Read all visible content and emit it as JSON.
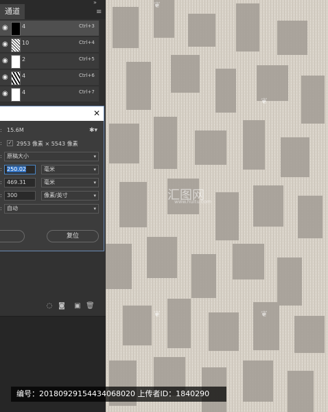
{
  "panel": {
    "tab_label": "通道",
    "collapse_glyph": "»",
    "menu_icon": "menu-lines-icon",
    "channels": [
      {
        "name": "4",
        "shortcut": "Ctrl+3",
        "thumb": "black",
        "selected": true
      },
      {
        "name": "10",
        "shortcut": "Ctrl+4",
        "thumb": "speck",
        "selected": false
      },
      {
        "name": "2",
        "shortcut": "Ctrl+5",
        "thumb": "white",
        "selected": false
      },
      {
        "name": "4",
        "shortcut": "Ctrl+6",
        "thumb": "zig",
        "selected": false
      },
      {
        "name": "4",
        "shortcut": "Ctrl+7",
        "thumb": "white",
        "selected": false
      }
    ],
    "bottom_icons": [
      "dotted-circle-icon",
      "mask-icon",
      "new-channel-icon",
      "trash-icon"
    ]
  },
  "dialog": {
    "close_glyph": "✕",
    "size_label": "15.6M",
    "dimensions": "2953 像素 × 5543 像素",
    "fit_to": "原稿大小",
    "width_value": "250.02",
    "width_unit": "毫米",
    "height_value": "469.31",
    "height_unit": "毫米",
    "resolution_value": "300",
    "resolution_unit": "像素/英寸",
    "resample": "自动",
    "reset_label": "复位",
    "check_glyph": "✓"
  },
  "footer": {
    "caption": "编号：20180929154434068020 上传者ID：1840290"
  },
  "watermark": {
    "brand": "汇图网",
    "url": "www.huitu.com"
  }
}
